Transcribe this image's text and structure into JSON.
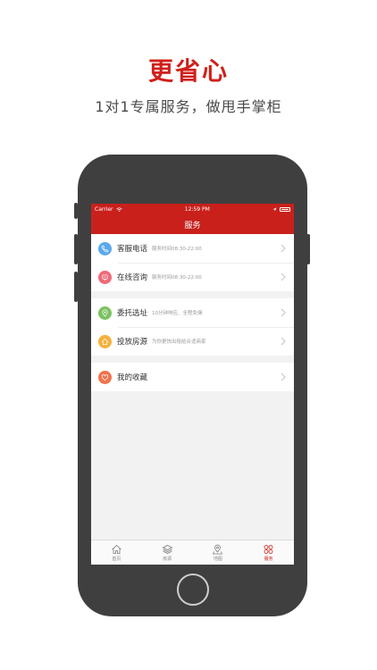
{
  "promo": {
    "headline": "更省心",
    "subline": "1对1专属服务，做甩手掌柜"
  },
  "status_bar": {
    "carrier": "Carrier",
    "time": "12:59 PM"
  },
  "nav": {
    "title": "服务"
  },
  "groups": [
    {
      "rows": [
        {
          "title": "客服电话",
          "desc": "服务时间08:30-22:00",
          "icon": "phone-icon",
          "color": "#5ba8ec"
        },
        {
          "title": "在线咨询",
          "desc": "服务时间08:30-22:00",
          "icon": "chat-icon",
          "color": "#f06a78"
        }
      ]
    },
    {
      "rows": [
        {
          "title": "委托选址",
          "desc": "10分钟响应、全程免佣",
          "icon": "location-icon",
          "color": "#7cc262"
        },
        {
          "title": "投放房源",
          "desc": "为你更快出租给合适商家",
          "icon": "house-icon",
          "color": "#f5b13c"
        }
      ]
    },
    {
      "rows": [
        {
          "title": "我的收藏",
          "desc": "",
          "icon": "heart-icon",
          "color": "#f2744f"
        }
      ]
    }
  ],
  "tabs": [
    {
      "label": "首页",
      "icon": "home-icon",
      "active": false
    },
    {
      "label": "房源",
      "icon": "layers-icon",
      "active": false
    },
    {
      "label": "地图",
      "icon": "map-pin-icon",
      "active": false
    },
    {
      "label": "服务",
      "icon": "service-icon",
      "active": true
    }
  ],
  "colors": {
    "brand_red": "#c9201c",
    "headline_red": "#d0201b"
  }
}
